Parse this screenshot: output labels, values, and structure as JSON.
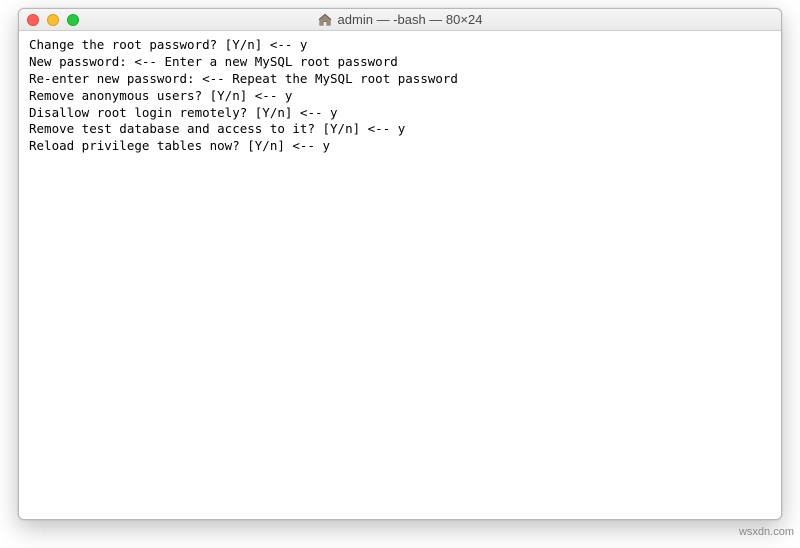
{
  "window": {
    "title": "admin — -bash — 80×24",
    "icon": "home-icon"
  },
  "terminal": {
    "lines": [
      "Change the root password? [Y/n] <-- y",
      "New password: <-- Enter a new MySQL root password",
      "Re-enter new password: <-- Repeat the MySQL root password",
      "Remove anonymous users? [Y/n] <-- y",
      "Disallow root login remotely? [Y/n] <-- y",
      "Remove test database and access to it? [Y/n] <-- y",
      "Reload privilege tables now? [Y/n] <-- y"
    ]
  },
  "watermark": "wsxdn.com"
}
